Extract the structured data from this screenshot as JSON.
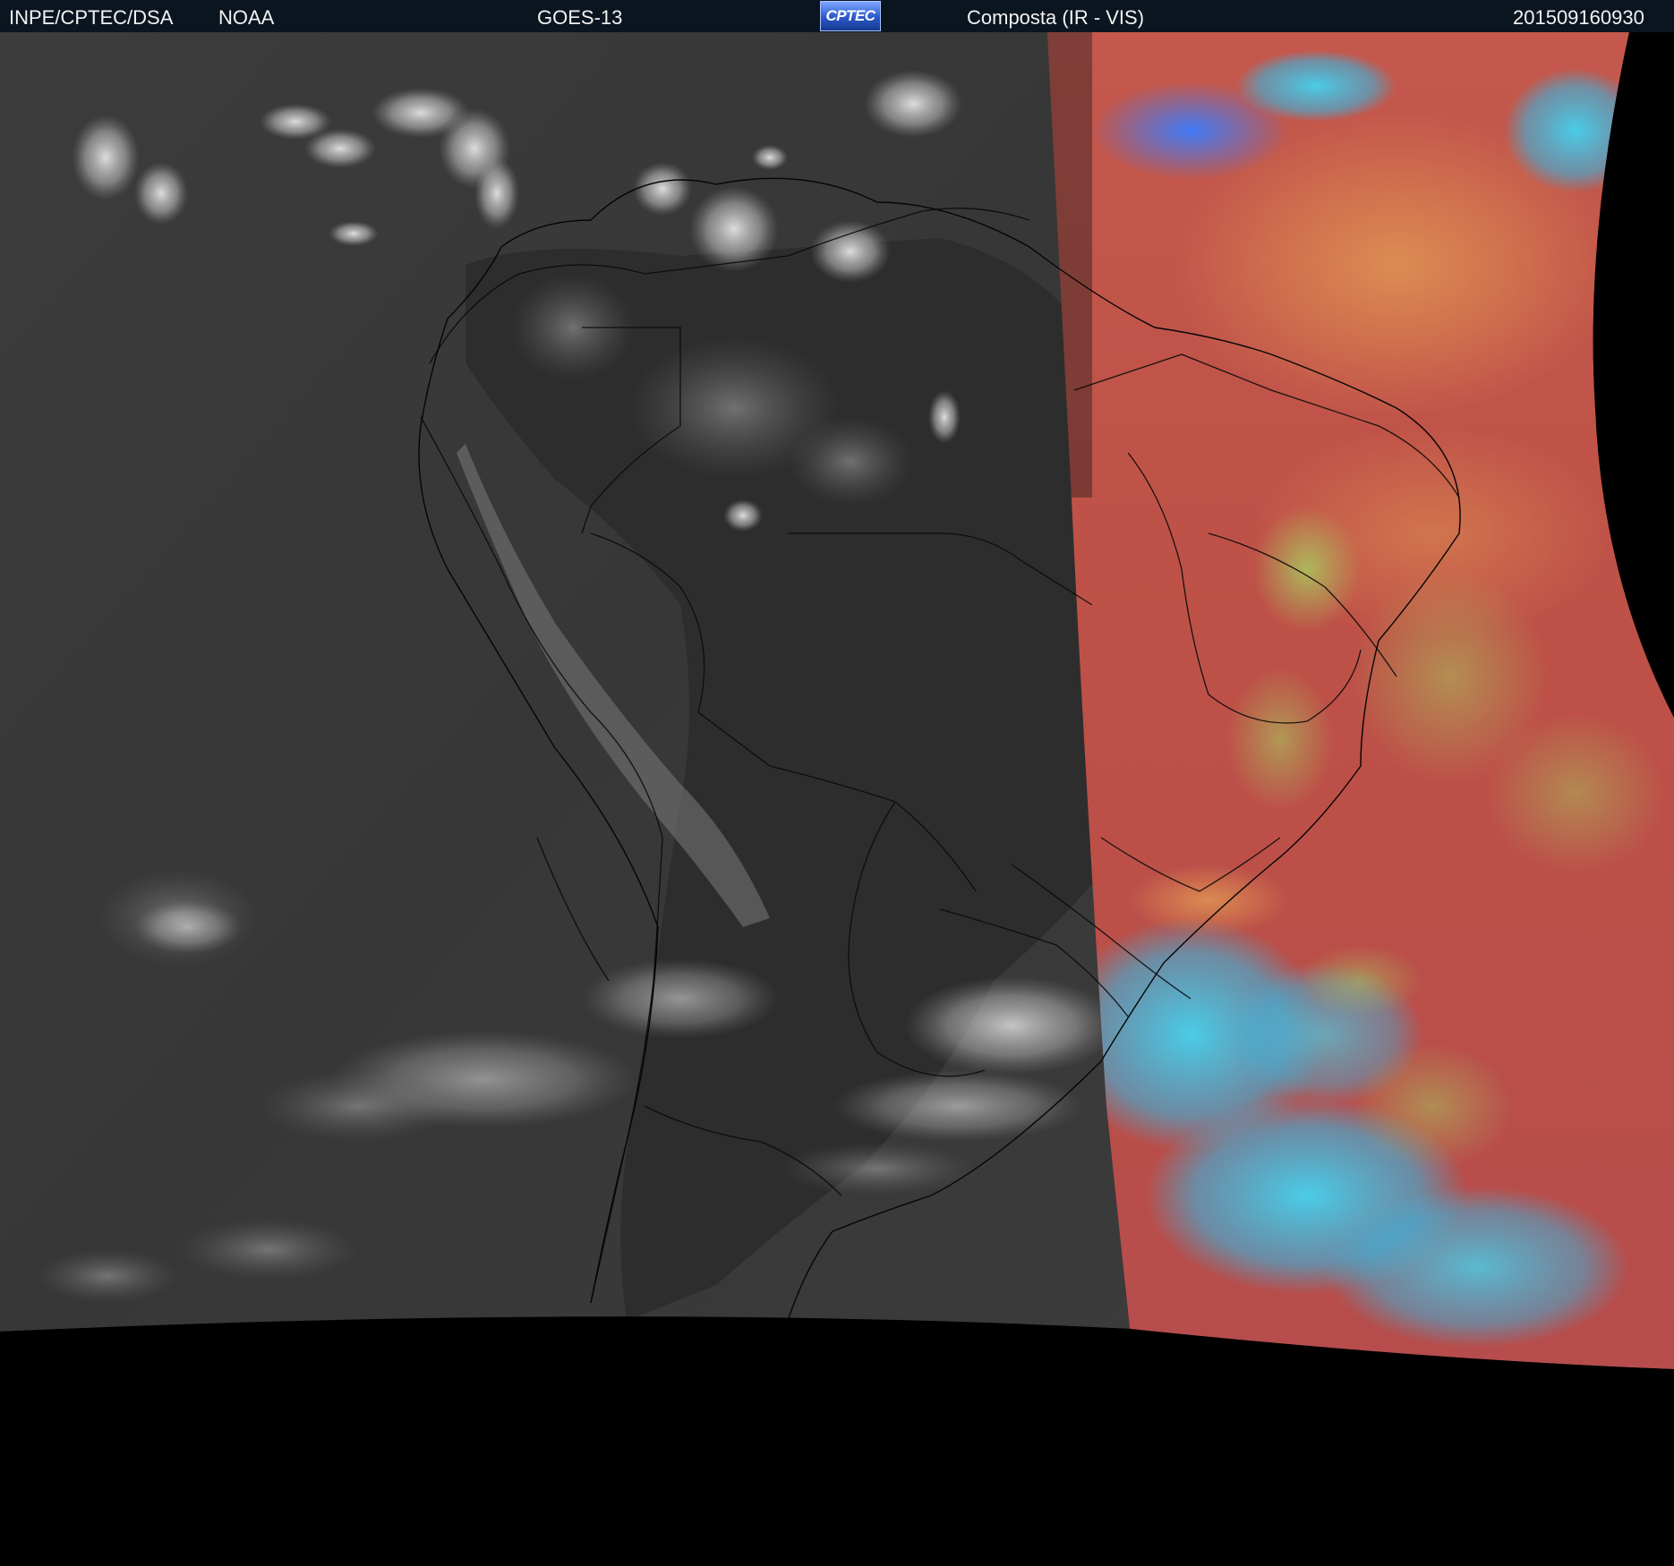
{
  "header": {
    "source": "INPE/CPTEC/DSA",
    "agency": "NOAA",
    "satellite": "GOES-13",
    "logo_text": "CPTEC",
    "product": "Composta (IR - VIS)",
    "timestamp": "201509160930"
  },
  "colors": {
    "header_bg": "#0b1520",
    "ir_gray": "#3d3d3d",
    "vis_red": "#c0524a",
    "vis_orange": "#d88a4c",
    "vis_green": "#9bbf5a",
    "vis_cyan": "#39c7e8",
    "space": "#000000"
  },
  "icons": {
    "logo": "cptec-logo"
  }
}
